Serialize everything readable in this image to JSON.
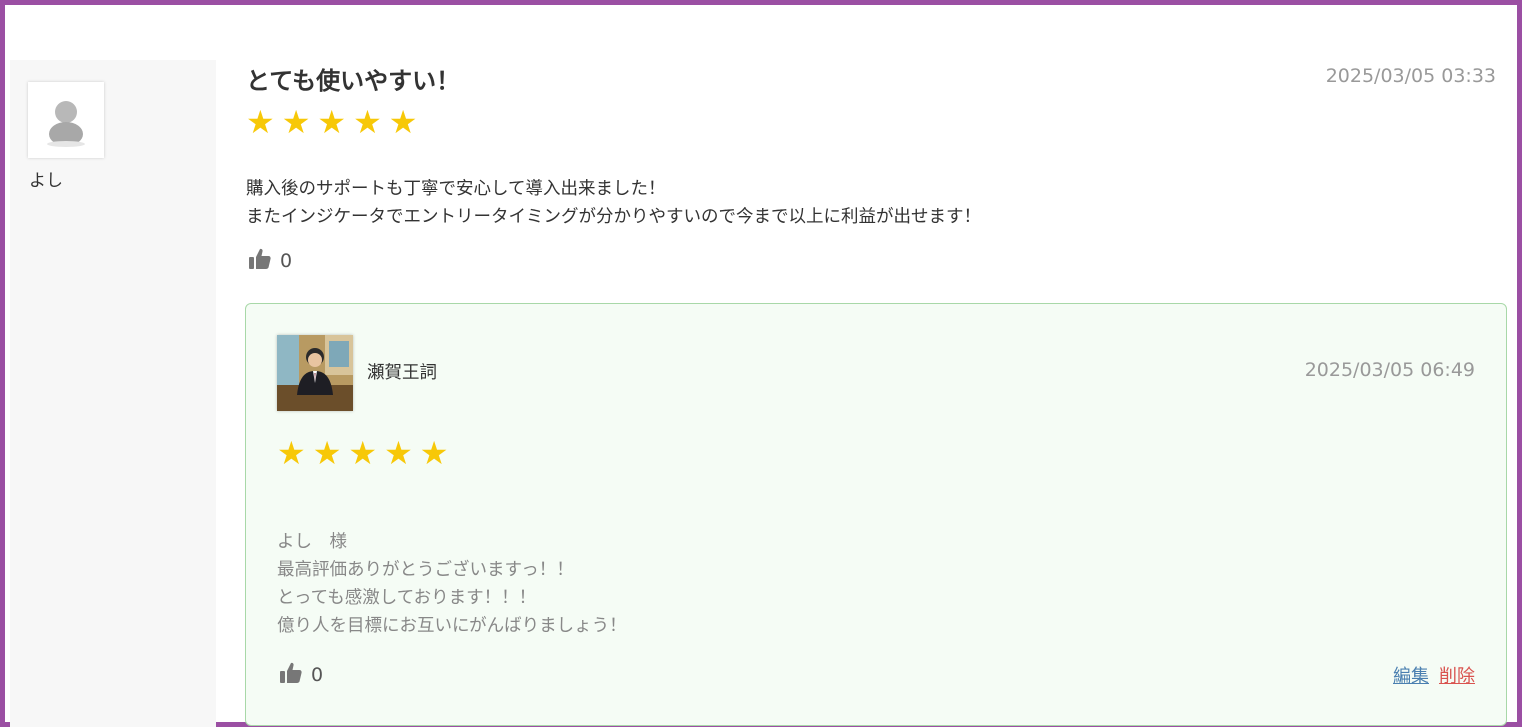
{
  "review": {
    "user_name": "よし",
    "title": "とても使いやすい！",
    "date": "2025/03/05 03:33",
    "rating": 5,
    "body_lines": [
      "購入後のサポートも丁寧で安心して導入出来ました！",
      "またインジケータでエントリータイミングが分かりやすいので今まで以上に利益が出せます！"
    ],
    "like_count": "0",
    "icons": {
      "avatar": "default-user-avatar-icon",
      "like": "thumbs-up-icon",
      "star": "star-icon"
    }
  },
  "reply": {
    "author_name": "瀬賀王詞",
    "date": "2025/03/05 06:49",
    "rating": 5,
    "body_lines": [
      "よし　様",
      "最高評価ありがとうございますっ！！",
      "とっても感激しております！！！",
      "億り人を目標にお互いにがんばりましょう！"
    ],
    "like_count": "0",
    "edit_label": "編集",
    "delete_label": "削除"
  },
  "colors": {
    "frame_border": "#9b4fa3",
    "star": "#f7c808",
    "reply_bg": "#f5fcf5",
    "reply_border": "#a8d8a8",
    "edit_link": "#4a7fb0",
    "delete_link": "#d9534f"
  }
}
